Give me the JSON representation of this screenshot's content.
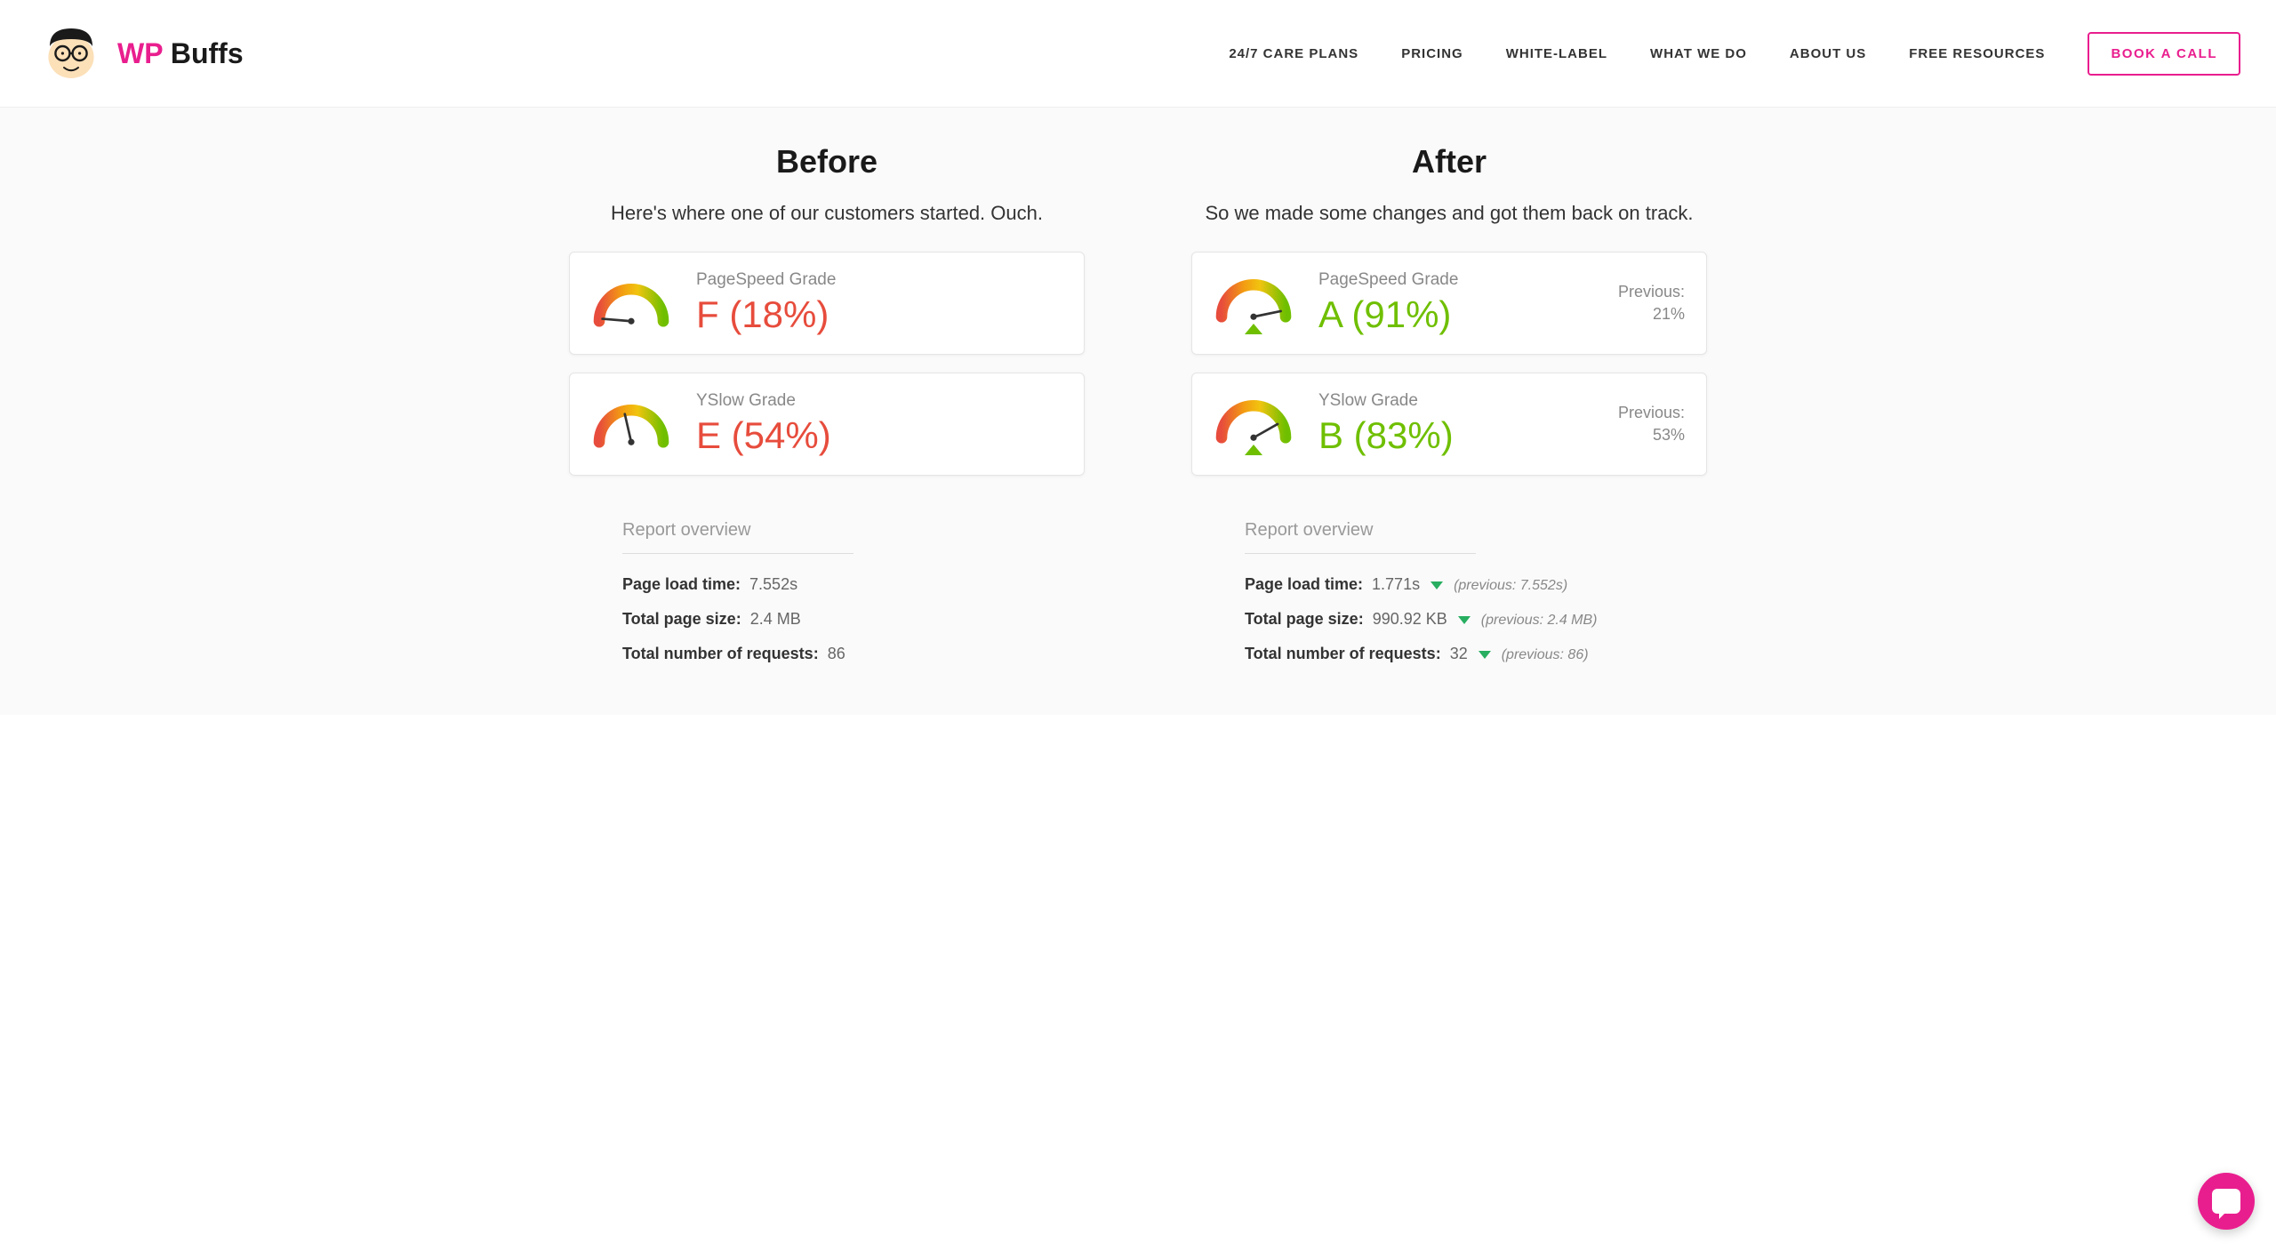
{
  "logo": {
    "wp": "WP",
    "buffs": " Buffs"
  },
  "nav": {
    "care_plans": "24/7 CARE PLANS",
    "pricing": "PRICING",
    "white_label": "WHITE-LABEL",
    "what_we_do": "WHAT WE DO",
    "about_us": "ABOUT US",
    "free_resources": "FREE RESOURCES",
    "book_call": "BOOK A CALL"
  },
  "before": {
    "title": "Before",
    "subtitle": "Here's where one of our customers started. Ouch.",
    "pagespeed": {
      "label": "PageSpeed Grade",
      "grade": "F (18%)"
    },
    "yslow": {
      "label": "YSlow Grade",
      "grade": "E (54%)"
    },
    "overview_title": "Report overview",
    "load_time": {
      "label": "Page load time:",
      "value": "7.552s"
    },
    "page_size": {
      "label": "Total page size:",
      "value": "2.4 MB"
    },
    "requests": {
      "label": "Total number of requests:",
      "value": "86"
    }
  },
  "after": {
    "title": "After",
    "subtitle": "So we made some changes and got them back on track.",
    "pagespeed": {
      "label": "PageSpeed Grade",
      "grade": "A (91%)",
      "prev_label": "Previous:",
      "prev_value": "21%"
    },
    "yslow": {
      "label": "YSlow Grade",
      "grade": "B (83%)",
      "prev_label": "Previous:",
      "prev_value": "53%"
    },
    "overview_title": "Report overview",
    "load_time": {
      "label": "Page load time:",
      "value": "1.771s",
      "prev": "(previous: 7.552s)"
    },
    "page_size": {
      "label": "Total page size:",
      "value": "990.92 KB",
      "prev": "(previous: 2.4 MB)"
    },
    "requests": {
      "label": "Total number of requests:",
      "value": "32",
      "prev": "(previous: 86)"
    }
  }
}
